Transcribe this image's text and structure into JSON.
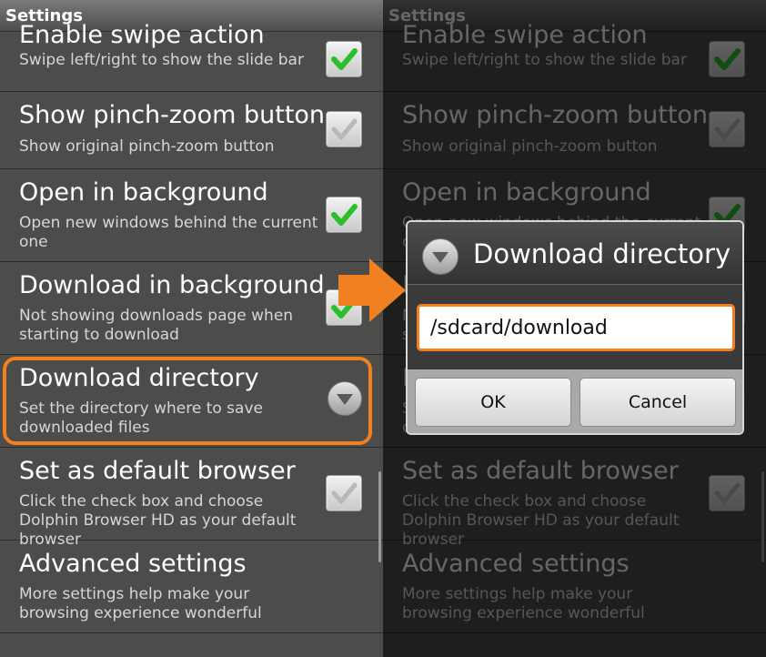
{
  "title_bar": {
    "title": "Settings"
  },
  "settings": [
    {
      "title": "Enable swipe action",
      "summary": "Swipe left/right to show the slide bar",
      "control": "checkbox",
      "checked": true
    },
    {
      "title": "Show pinch-zoom button",
      "summary": "Show original pinch-zoom button",
      "control": "checkbox",
      "checked": false
    },
    {
      "title": "Open in background",
      "summary": "Open new windows behind the current one",
      "control": "checkbox",
      "checked": true
    },
    {
      "title": "Download in background",
      "summary": "Not showing downloads page when starting to download",
      "control": "checkbox",
      "checked": true
    },
    {
      "title": "Download directory",
      "summary": "Set the directory where to save downloaded files",
      "control": "dropdown",
      "highlighted": true
    },
    {
      "title": "Set as default browser",
      "summary": "Click the check box and choose Dolphin Browser HD as your default browser",
      "control": "checkbox",
      "checked": false
    },
    {
      "title": "Advanced settings",
      "summary": "More settings help make your browsing experience wonderful",
      "control": "none"
    }
  ],
  "dialog": {
    "title": "Download directory",
    "input_value": "/sdcard/download",
    "ok_label": "OK",
    "cancel_label": "Cancel"
  },
  "colors": {
    "accent_orange": "#f08020",
    "check_green": "#2bbf2b",
    "panel_bg": "#4c4c4a"
  }
}
